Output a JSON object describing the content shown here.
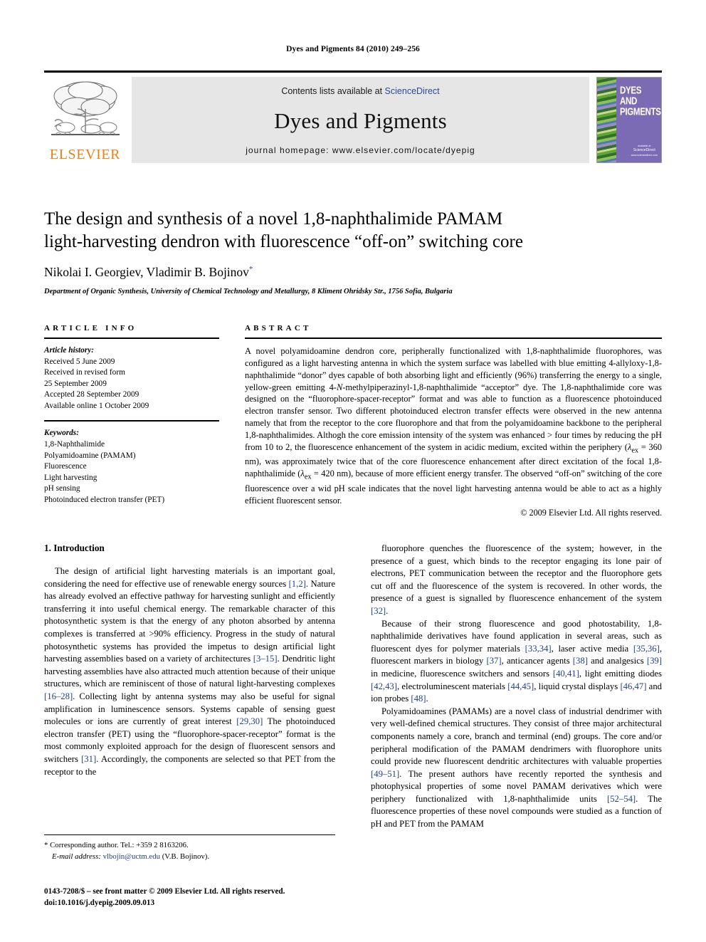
{
  "running_head": "Dyes and Pigments 84 (2010) 249–256",
  "masthead": {
    "publisher_logo_text": "ELSEVIER",
    "contents_prefix": "Contents lists available at ",
    "contents_link": "ScienceDirect",
    "journal_title": "Dyes and Pigments",
    "homepage": "journal homepage: www.elsevier.com/locate/dyepig",
    "cover": {
      "line1": "Dyes",
      "line2": "and",
      "line3": "Pigments",
      "sd_caption": "available at",
      "sd_brand": "ScienceDirect",
      "sd_url": "www.sciencedirect.com"
    },
    "colors": {
      "elsevier_orange": "#ea8019",
      "band_gray": "#e6e6e6",
      "link_blue": "#2b4a9b",
      "cover_purple": "#7b6bb5"
    }
  },
  "article": {
    "title_line1": "The design and synthesis of a novel 1,8-naphthalimide PAMAM",
    "title_line2": "light-harvesting dendron with fluorescence “off-on” switching core",
    "authors": "Nikolai I. Georgiev, Vladimir B. Bojinov",
    "author_marker": "*",
    "affiliation": "Department of Organic Synthesis, University of Chemical Technology and Metallurgy, 8 Kliment Ohridsky Str., 1756 Sofia, Bulgaria"
  },
  "article_info": {
    "heading": "ARTICLE INFO",
    "history_label": "Article history:",
    "history": [
      "Received 5 June 2009",
      "Received in revised form",
      "25 September 2009",
      "Accepted 28 September 2009",
      "Available online 1 October 2009"
    ],
    "keywords_label": "Keywords:",
    "keywords": [
      "1,8-Naphthalimide",
      "Polyamidoamine (PAMAM)",
      "Fluorescence",
      "Light harvesting",
      "pH sensing",
      "Photoinduced electron transfer (PET)"
    ]
  },
  "abstract": {
    "heading": "ABSTRACT",
    "text": "A novel polyamidoamine dendron core, peripherally functionalized with 1,8-naphthalimide fluorophores, was configured as a light harvesting antenna in which the system surface was labelled with blue emitting 4-allyloxy-1,8-naphthalimide “donor” dyes capable of both absorbing light and efficiently (96%) transferring the energy to a single, yellow-green emitting 4-N-methylpiperazinyl-1,8-naphthalimide “acceptor” dye. The 1,8-naphthalimide core was designed on the “fluorophore-spacer-receptor” format and was able to function as a fluorescence photoinduced electron transfer sensor. Two different photoinduced electron transfer effects were observed in the new antenna namely that from the receptor to the core fluorophore and that from the polyamidoamine backbone to the peripheral 1,8-naphthalimides. Althogh the core emission intensity of the system was enhanced > four times by reducing the pH from 10 to 2, the fluorescence enhancement of the system in acidic medium, excited within the periphery (λex = 360 nm), was approximately twice that of the core fluorescence enhancement after direct excitation of the focal 1,8-naphthalimide (λex = 420 nm), because of more efficient energy transfer. The observed “off-on” switching of the core fluorescence over a wid pH scale indicates that the novel light harvesting antenna would be able to act as a highly efficient fluorescent sensor.",
    "copyright": "© 2009 Elsevier Ltd. All rights reserved."
  },
  "introduction": {
    "heading": "1. Introduction",
    "left_paragraph": "The design of artificial light harvesting materials is an important goal, considering the need for effective use of renewable energy sources [1,2]. Nature has already evolved an effective pathway for harvesting sunlight and efficiently transferring it into useful chemical energy. The remarkable character of this photosynthetic system is that the energy of any photon absorbed by antenna complexes is transferred at >90% efficiency. Progress in the study of natural photosynthetic systems has provided the impetus to design artificial light harvesting assemblies based on a variety of architectures [3–15]. Dendritic light harvesting assemblies have also attracted much attention because of their unique structures, which are reminiscent of those of natural light-harvesting complexes [16–28]. Collecting light by antenna systems may also be useful for signal amplification in luminescence sensors. Systems capable of sensing guest molecules or ions are currently of great interest [29,30] The photoinduced electron transfer (PET) using the “fluorophore-spacer-receptor” format is the most commonly exploited approach for the design of fluorescent sensors and switchers [31]. Accordingly, the components are selected so that PET from the receptor to the",
    "right_paragraph_1": "fluorophore quenches the fluorescence of the system; however, in the presence of a guest, which binds to the receptor engaging its lone pair of electrons, PET communication between the receptor and the fluorophore gets cut off and the fluorescence of the system is recovered. In other words, the presence of a guest is signalled by fluorescence enhancement of the system [32].",
    "right_paragraph_2": "Because of their strong fluorescence and good photostability, 1,8-naphthalimide derivatives have found application in several areas, such as fluorescent dyes for polymer materials [33,34], laser active media [35,36], fluorescent markers in biology [37], anticancer agents [38] and analgesics [39] in medicine, fluorescence switchers and sensors [40,41], light emitting diodes [42,43], electroluminescent materials [44,45], liquid crystal displays [46,47] and ion probes [48].",
    "right_paragraph_3": "Polyamidoamines (PAMAMs) are a novel class of industrial dendrimer with very well-defined chemical structures. They consist of three major architectural components namely a core, branch and terminal (end) groups. The core and/or peripheral modification of the PAMAM dendrimers with fluorophore units could provide new fluorescent dendritic architectures with valuable properties [49–51]. The present authors have recently reported the synthesis and photophysical properties of some novel PAMAM derivatives which were periphery functionalized with 1,8-naphthalimide units [52–54]. The fluorescence properties of these novel compounds were studied as a function of pH and PET from the PAMAM"
  },
  "footnote": {
    "corresponding": "* Corresponding author. Tel.: +359 2 8163206.",
    "email_label": "E-mail address:",
    "email": "vlbojin@uctm.edu",
    "email_suffix": "(V.B. Bojinov)."
  },
  "footer": {
    "line1": "0143-7208/$ – see front matter © 2009 Elsevier Ltd. All rights reserved.",
    "line2": "doi:10.1016/j.dyepig.2009.09.013"
  }
}
